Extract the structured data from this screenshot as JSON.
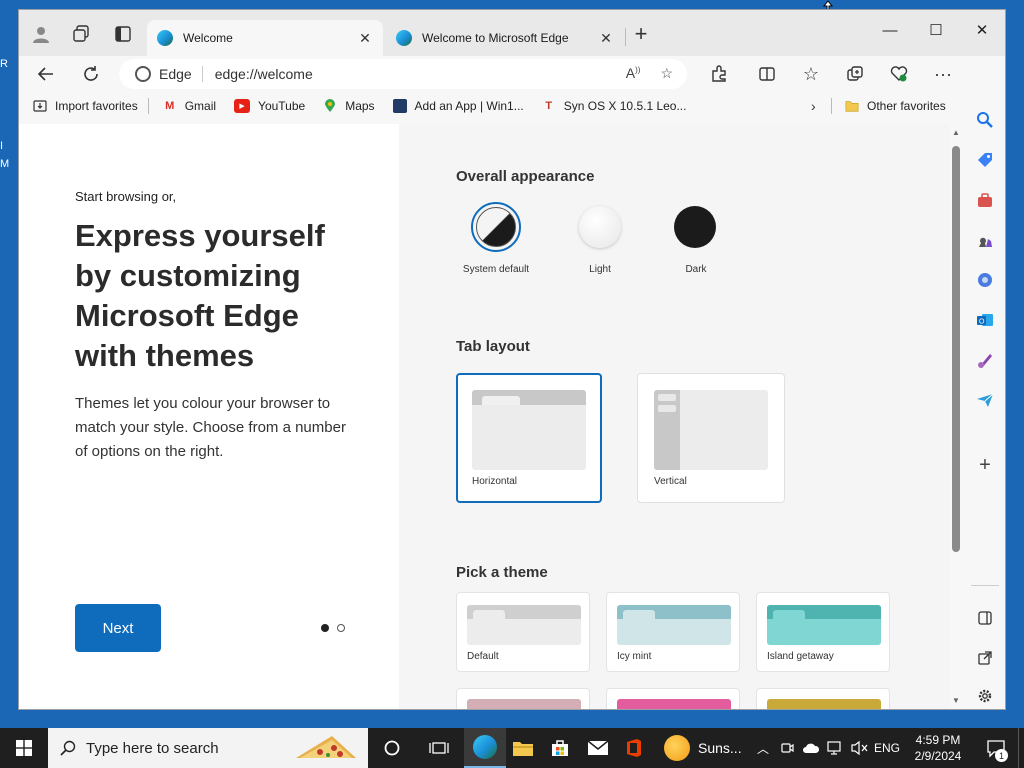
{
  "desktop": {
    "frag1": "R",
    "frag2": "I",
    "frag3": "M"
  },
  "tabs": [
    {
      "title": "Welcome",
      "close": "✕"
    },
    {
      "title": "Welcome to Microsoft Edge",
      "close": "✕"
    }
  ],
  "new_tab": "+",
  "window_controls": {
    "minimize": "—",
    "maximize": "☐",
    "close": "✕"
  },
  "address": {
    "site_label": "Edge",
    "url": "edge://welcome"
  },
  "favorites": [
    {
      "label": "Import favorites",
      "icon": "import-icon",
      "color": "#333333"
    },
    {
      "label": "Gmail",
      "icon": "gmail-icon",
      "color": "#d93025"
    },
    {
      "label": "YouTube",
      "icon": "youtube-icon",
      "color": "#e62117"
    },
    {
      "label": "Maps",
      "icon": "maps-icon",
      "color": "#34a853"
    },
    {
      "label": "Add an App | Win1...",
      "icon": "app-icon",
      "color": "#1f3b66"
    },
    {
      "label": "Syn OS X 10.5.1 Leo...",
      "icon": "syn-icon",
      "color": "#c0392b"
    }
  ],
  "other_favorites": "Other favorites",
  "welcome": {
    "kicker": "Start browsing or,",
    "headline": "Express yourself by customizing Microsoft Edge with themes",
    "body": "Themes let you colour your browser to match your style. Choose from a number of options on the right.",
    "next_label": "Next"
  },
  "appearance": {
    "heading": "Overall appearance",
    "options": [
      "System default",
      "Light",
      "Dark"
    ],
    "selected": "System default"
  },
  "tab_layout": {
    "heading": "Tab layout",
    "options": [
      "Horizontal",
      "Vertical"
    ],
    "selected": "Horizontal"
  },
  "theme": {
    "heading": "Pick a theme",
    "options": [
      {
        "name": "Default",
        "color": "#cfcfcf",
        "body": "#ececec"
      },
      {
        "name": "Icy mint",
        "color": "#8dc0c8",
        "body": "#cfe5e8"
      },
      {
        "name": "Island getaway",
        "color": "#4fb3b0",
        "body": "#7fd6d3"
      }
    ],
    "next_row_colors": [
      "#d4aeb5",
      "#e35d9e",
      "#c9a93a"
    ]
  },
  "taskbar": {
    "search_placeholder": "Type here to search",
    "weather_label": "Suns...",
    "lang": "ENG",
    "time": "4:59 PM",
    "date": "2/9/2024",
    "notification_count": "1"
  },
  "colors": {
    "accent": "#0f6cbd",
    "desktop": "#1b67b6",
    "taskbar": "#1f1f1f"
  }
}
